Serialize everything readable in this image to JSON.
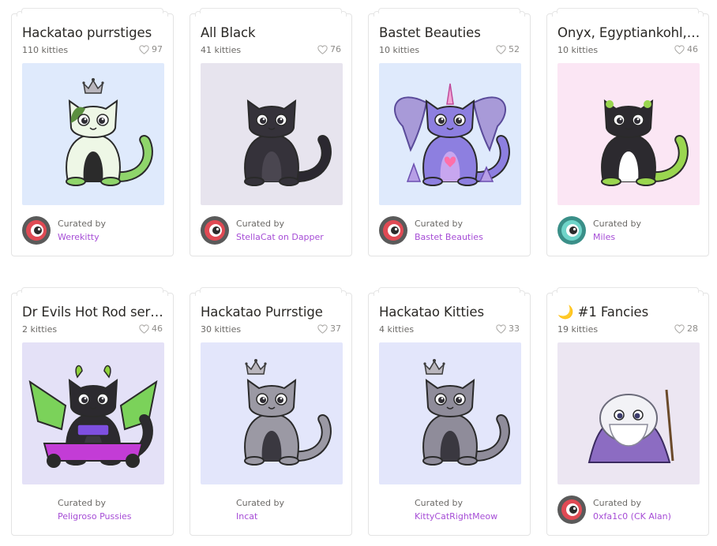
{
  "colors": {
    "accent_link": "#a64dd6",
    "card_border": "#e3e3e3",
    "muted_text": "#6b6966"
  },
  "curated_by_label": "Curated by",
  "cards": [
    {
      "title": "Hackatao purrstiges",
      "count": "110 kitties",
      "likes": "97",
      "bg": "#dfeafc",
      "curator": "Werekitty",
      "avatar": "red-eye-avatar",
      "cat": "green-spotted-cat-with-crown"
    },
    {
      "title": "All Black",
      "count": "41 kitties",
      "likes": "76",
      "bg": "#e7e4ee",
      "curator": "StellaCat on Dapper",
      "avatar": "red-eye-avatar",
      "cat": "black-cat"
    },
    {
      "title": "Bastet Beauties",
      "count": "10 kitties",
      "likes": "52",
      "bg": "#dfeafc",
      "curator": "Bastet Beauties",
      "avatar": "red-eye-avatar",
      "cat": "purple-winged-unicorn-cat"
    },
    {
      "title": "Onyx, Egyptiankohl, ...",
      "count": "10 kitties",
      "likes": "46",
      "bg": "#fbe6f4",
      "curator": "Miles",
      "avatar": "teal-eye-avatar",
      "cat": "black-white-green-cat"
    },
    {
      "title": "Dr Evils Hot Rod seri...",
      "count": "2 kitties",
      "likes": "46",
      "bg": "#e4e1f7",
      "curator": "Peligroso Pussies",
      "avatar": "none",
      "cat": "winged-cat-in-kart"
    },
    {
      "title": "Hackatao Purrstige",
      "count": "30 kitties",
      "likes": "37",
      "bg": "#e3e6fb",
      "curator": "Incat",
      "avatar": "none",
      "cat": "grey-cat-with-crown"
    },
    {
      "title": "Hackatao Kitties",
      "count": "4 kitties",
      "likes": "33",
      "bg": "#e3e6fb",
      "curator": "KittyCatRightMeow",
      "avatar": "none",
      "cat": "grey-cat-with-crown-2"
    },
    {
      "title": "🌙 #1 Fancies",
      "count": "19 kitties",
      "likes": "28",
      "bg": "#ece6f2",
      "curator": "0xfa1c0 (CK Alan)",
      "avatar": "red-eye-avatar",
      "cat": "white-wizard-cat"
    }
  ]
}
